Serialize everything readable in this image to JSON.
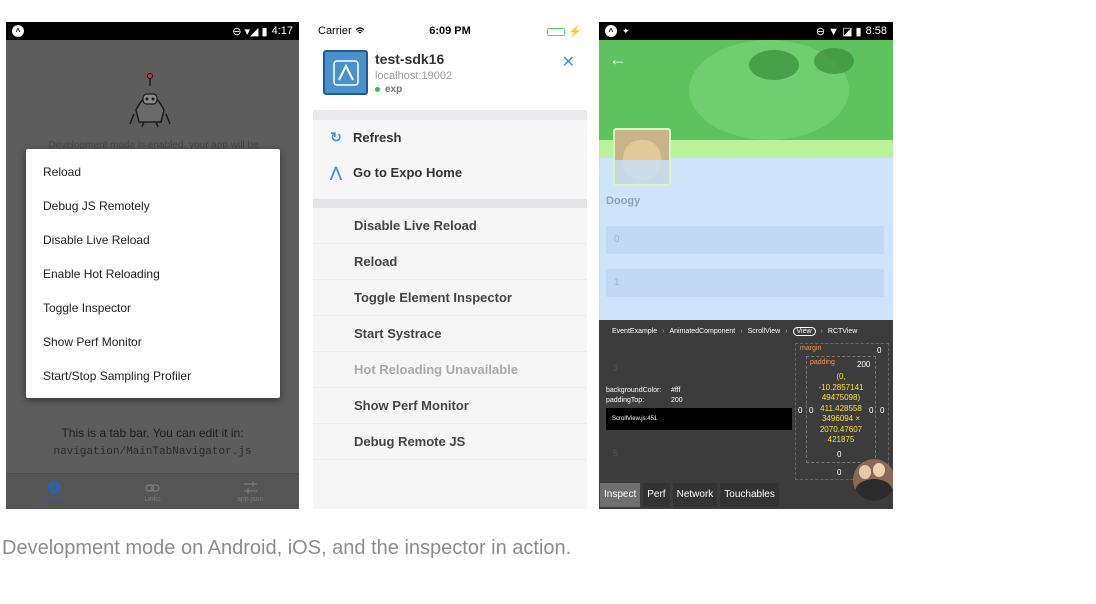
{
  "android": {
    "status_time": "4:17",
    "status_icons": "⊖ ▾◢ ▮",
    "logo_badge": "^",
    "behind_text": "Development mode is enabled, your app will be",
    "menu_items": [
      "Reload",
      "Debug JS Remotely",
      "Disable Live Reload",
      "Enable Hot Reloading",
      "Toggle Inspector",
      "Show Perf Monitor",
      "Start/Stop Sampling Profiler"
    ],
    "tab_text": "This is a tab bar. You can edit it in:",
    "tab_path": "navigation/MainTabNavigator.js",
    "tabs": [
      "Home",
      "Links",
      "app.json"
    ],
    "home_glyph": "i",
    "accent": "#2e62a3"
  },
  "ios": {
    "carrier": "Carrier",
    "time": "6:09 PM",
    "app_title": "test-sdk16",
    "host": "localhost:19002",
    "tag": "exp",
    "close_glyph": "✕",
    "top_items": [
      {
        "icon": "refresh-icon",
        "glyph": "↻",
        "label": "Refresh"
      },
      {
        "icon": "expo-icon",
        "glyph": "⋀",
        "label": "Go to Expo Home"
      }
    ],
    "items": [
      {
        "label": "Disable Live Reload",
        "disabled": false
      },
      {
        "label": "Reload",
        "disabled": false
      },
      {
        "label": "Toggle Element Inspector",
        "disabled": false
      },
      {
        "label": "Start Systrace",
        "disabled": false
      },
      {
        "label": "Hot Reloading Unavailable",
        "disabled": true
      },
      {
        "label": "Show Perf Monitor",
        "disabled": false
      },
      {
        "label": "Debug Remote JS",
        "disabled": false
      }
    ],
    "accent": "#4a90e2"
  },
  "inspector": {
    "status_time": "8:58",
    "status_icons": "⊖ ▼ ◪ ▮",
    "logo_badge": "^",
    "back_glyph": "←",
    "name": "Doogy",
    "fields": [
      "0",
      "1"
    ],
    "bg_numbers": [
      "3",
      "5"
    ],
    "breadcrumb": [
      "EventExample",
      "AnimatedComponent",
      "ScrollView",
      "View",
      "RCTView"
    ],
    "breadcrumb_selected": "View",
    "styles": [
      {
        "key": "backgroundColor:",
        "value": "#fff"
      },
      {
        "key": "paddingTop:",
        "value": "200"
      }
    ],
    "source_file": "ScrollView.js:451",
    "box": {
      "margin_label": "margin",
      "padding_label": "padding",
      "margin_top": "0",
      "margin_bottom": "0",
      "margin_left": "0",
      "margin_right": "0",
      "padding_top": "200",
      "padding_bottom": "0",
      "padding_left": "0",
      "padding_right": "0",
      "size_text": "(0, -10.2857141 49475098) 411.428558 3496094 × 2070.47607 421875"
    },
    "tabs": [
      "Inspect",
      "Perf",
      "Network",
      "Touchables"
    ],
    "active_tab": "Inspect"
  },
  "caption": "Development mode on Android, iOS, and the inspector in action."
}
